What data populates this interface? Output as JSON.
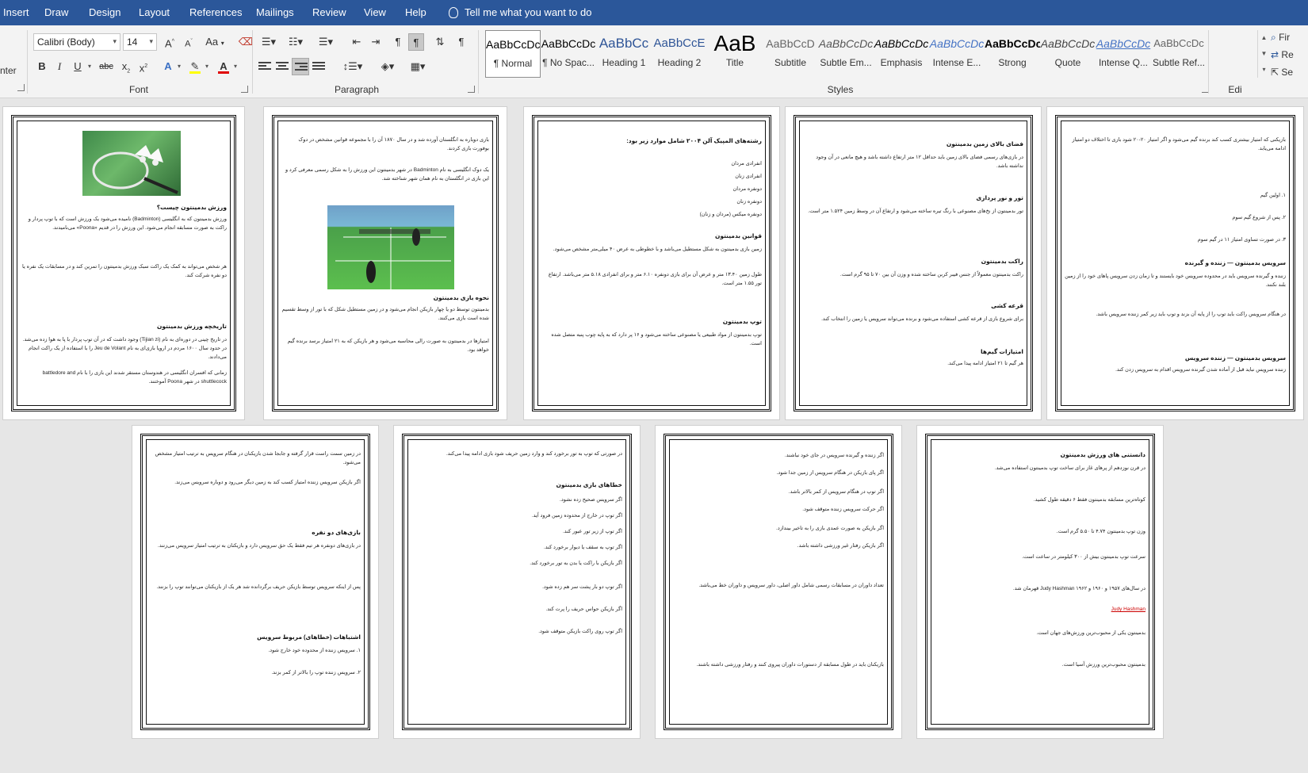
{
  "tabs": [
    "Insert",
    "Draw",
    "Design",
    "Layout",
    "References",
    "Mailings",
    "Review",
    "View",
    "Help"
  ],
  "tell_me": "Tell me what you want to do",
  "font": {
    "name": "Calibri (Body)",
    "size": "14",
    "label": "Font",
    "grow": "A",
    "shrink": "A",
    "case": "Aa",
    "bold": "B",
    "italic": "I",
    "underline": "U",
    "strike": "abc",
    "subscript": "x",
    "superscript": "x"
  },
  "paragraph": {
    "label": "Paragraph"
  },
  "clipboard_fragment": "nter",
  "styles": {
    "label": "Styles",
    "items": [
      {
        "sample": "AaBbCcDc",
        "name": "¶ Normal"
      },
      {
        "sample": "AaBbCcDc",
        "name": "¶ No Spac..."
      },
      {
        "sample": "AaBbCc",
        "name": "Heading 1"
      },
      {
        "sample": "AaBbCcE",
        "name": "Heading 2"
      },
      {
        "sample": "AaB",
        "name": "Title"
      },
      {
        "sample": "AaBbCcD",
        "name": "Subtitle"
      },
      {
        "sample": "AaBbCcDc",
        "name": "Subtle Em..."
      },
      {
        "sample": "AaBbCcDc",
        "name": "Emphasis"
      },
      {
        "sample": "AaBbCcDc",
        "name": "Intense E..."
      },
      {
        "sample": "AaBbCcDc",
        "name": "Strong"
      },
      {
        "sample": "AaBbCcDc",
        "name": "Quote"
      },
      {
        "sample": "AaBbCcDc",
        "name": "Intense Q..."
      },
      {
        "sample": "AaBbCcDc",
        "name": "Subtle Ref..."
      }
    ]
  },
  "editing": {
    "find": "Fir",
    "replace": "Re",
    "select": "Se",
    "label": "Edi"
  },
  "doc": {
    "p1": {
      "h1": "ورزش بدمینتون چیست؟",
      "t1": "ورزش بدمینتون که به انگلیسی (Badminton) نامیده می‌شود یک ورزش است که با توپ پردار و راکت به صورت مسابقه انجام می‌شود. این ورزش را در قدیم «Poona» می‌نامیدند.",
      "t2": "هر شخص می‌تواند به کمک یک راکت سبک ورزش بدمینتون را تمرین کند و در مسابقات یک نفره یا دو نفره شرکت کند.",
      "h2": "تاریخچه ورزش بدمینتون",
      "t3": "در تاریخ چینی در دوره‌ای به نام (Tijian zi) وجود داشت که در آن توپ پردار با پا به هوا زده می‌شد. در حدود سال ۱۶۰۰ مردم در اروپا بازی‌ای به نام Jeu de Volant را با استفاده از یک راکت انجام می‌دادند.",
      "t4": "زمانی که افسران انگلیسی در هندوستان مستقر شدند این بازی را با نام battledore and shuttlecock در شهر Poona آموختند."
    },
    "p2": {
      "t1": "بازی دوباره به انگلستان آورده شد و در سال ۱۸۷۰ آن را با مجموعه قوانین مشخص در دوک بوفورت بازی کردند.",
      "t2": "یک دوک انگلیسی به نام Badminton در شهر بدمینتون این ورزش را به شکل رسمی معرفی کرد و این بازی در انگلستان به نام همان شهر شناخته شد.",
      "h1": "نحوه بازی بدمینتون",
      "t3": "بدمینتون توسط دو یا چهار بازیکن انجام می‌شود و در زمین مستطیل شکل که با تور از وسط تقسیم شده است بازی می‌کنند.",
      "t4": "امتیازها در بدمینتون به صورت رالی محاسبه می‌شود و هر بازیکن که به ۲۱ امتیاز برسد برنده گیم خواهد بود."
    },
    "p3": {
      "h1": "رشته‌های المپیک آلن ۲۰۰۴ شامل موارد زیر بود:",
      "items": [
        "انفرادی مردان",
        "انفرادی زنان",
        "دونفره مردان",
        "دونفره زنان",
        "دونفره میکس (مردان و زنان)"
      ],
      "h2": "قوانین بدمینتون",
      "t1": "زمین بازی بدمینتون به شکل مستطیل می‌باشد و با خطوطی به عرض ۴۰ میلی‌متر مشخص می‌شود.",
      "t2": "طول زمین ۱۳.۴۰ متر و عرض آن برای بازی دونفره ۶.۱۰ متر و برای انفرادی ۵.۱۸ متر می‌باشد. ارتفاع تور ۱.۵۵ متر است.",
      "h3": "توپ بدمینتون",
      "t3": "توپ بدمینتون از مواد طبیعی یا مصنوعی ساخته می‌شود و ۱۶ پر دارد که به پایه چوب پنبه متصل شده است."
    },
    "p4": {
      "h1": "فضای بالای زمین بدمینتون",
      "t1": "در بازی‌های رسمی فضای بالای زمین باید حداقل ۱۲ متر ارتفاع داشته باشد و هیچ مانعی در آن وجود نداشته باشد.",
      "h2": "تور و نور پردازی",
      "t2": "تور بدمینتون از نخ‌های مصنوعی با رنگ تیره ساخته می‌شود و ارتفاع آن در وسط زمین ۱.۵۲۴ متر است.",
      "h3": "راکت بدمینتون",
      "t3": "راکت بدمینتون معمولاً از جنس فیبر کربن ساخته شده و وزن آن بین ۷۰ تا ۹۵ گرم است.",
      "h4": "قرعه کشی",
      "t4": "برای شروع بازی از قرعه کشی استفاده می‌شود و برنده می‌تواند سرویس یا زمین را انتخاب کند.",
      "h5": "امتیازات گیم‌ها",
      "t5": "هر گیم تا ۲۱ امتیاز ادامه پیدا می‌کند."
    },
    "p5": {
      "t1": "بازیکنی که امتیاز بیشتری کسب کند برنده گیم می‌شود و اگر امتیاز ۲۰-۲۰ شود بازی تا اختلاف دو امتیاز ادامه می‌یابد.",
      "items": [
        "۱. اولین گیم",
        "۲. پس از شروع گیم سوم",
        "۳. در صورت تساوی امتیاز ۱۱ در گیم سوم"
      ],
      "h1": "سرویس بدمینتون — زننده و گیرنده",
      "t2": "زننده و گیرنده سرویس باید در محدوده سرویس خود بایستند و تا زمان زدن سرویس پاهای خود را از زمین بلند نکنند.",
      "t3": "در هنگام سرویس راکت باید توپ را از پایه آن بزند و توپ باید زیر کمر زننده سرویس باشد.",
      "h2": "سرویس بدمینتون — زننده سرویس",
      "t4": "زننده سرویس نباید قبل از آماده شدن گیرنده سرویس اقدام به سرویس زدن کند."
    },
    "p6": {
      "t1": "در زمین سمت راست قرار گرفته و جابجا شدن بازیکنان در هنگام سرویس به ترتیب امتیاز مشخص می‌شود.",
      "t2": "اگر بازیکن سرویس زننده امتیاز کسب کند به زمین دیگر می‌رود و دوباره سرویس می‌زند.",
      "h1": "بازی‌های دو نفره",
      "t3": "در بازی‌های دونفره هر تیم فقط یک حق سرویس دارد و بازیکنان به ترتیب امتیاز سرویس می‌زنند.",
      "t4": "پس از اینکه سرویس توسط بازیکن حریف برگردانده شد هر یک از بازیکنان می‌توانند توپ را بزنند.",
      "h2": "اشتباهات (خطاهای) مربوط سرویس",
      "items": [
        "۱. سرویس زننده از محدوده خود خارج شود.",
        "۲. سرویس زننده توپ را بالاتر از کمر بزند."
      ]
    },
    "p7": {
      "t1": "در صورتی که توپ به تور برخورد کند و وارد زمین حریف شود بازی ادامه پیدا می‌کند.",
      "h1": "خطاهای بازی بدمینتون",
      "items": [
        "اگر سرویس صحیح زده نشود.",
        "اگر توپ در خارج از محدوده زمین فرود آید.",
        "اگر توپ از زیر تور عبور کند.",
        "اگر توپ به سقف یا دیوار برخورد کند.",
        "اگر بازیکن با راکت یا بدن به تور برخورد کند.",
        "اگر توپ دو بار پشت سر هم زده شود.",
        "اگر بازیکن حواس حریف را پرت کند.",
        "اگر توپ روی راکت بازیکن متوقف شود."
      ]
    },
    "p8": {
      "items": [
        "اگر زننده و گیرنده سرویس در جای خود نباشند.",
        "اگر پای بازیکن در هنگام سرویس از زمین جدا شود.",
        "اگر توپ در هنگام سرویس از کمر بالاتر باشد.",
        "اگر حرکت سرویس زننده متوقف شود.",
        "اگر بازیکن به صورت عمدی بازی را به تاخیر بیندازد.",
        "اگر بازیکن رفتار غیر ورزشی داشته باشد."
      ],
      "t1": "تعداد داوران در مسابقات رسمی شامل داور اصلی، داور سرویس و داوران خط می‌باشد.",
      "t2": "بازیکنان باید در طول مسابقه از دستورات داوران پیروی کنند و رفتار ورزشی داشته باشند."
    },
    "p9": {
      "h1": "دانستنی های ورزش بدمینتون",
      "items": [
        "در قرن نوزدهم از پرهای غاز برای ساخت توپ بدمینتون استفاده می‌شد.",
        "کوتاه‌ترین مسابقه بدمینتون فقط ۶ دقیقه طول کشید.",
        "وزن توپ بدمینتون ۴.۷۴ تا ۵.۵۰ گرم است.",
        "سرعت توپ بدمینتون بیش از ۳۰۰ کیلومتر در ساعت است.",
        "در سال‌های ۱۹۵۷ و ۱۹۶۰ و ۱۹۶۲ Judy Hashman قهرمان شد.",
        "بدمینتون یکی از محبوب‌ترین ورزش‌های جهان است.",
        "بدمینتون محبوب‌ترین ورزش آسیا است."
      ],
      "name1": "Judy Hashman"
    }
  }
}
